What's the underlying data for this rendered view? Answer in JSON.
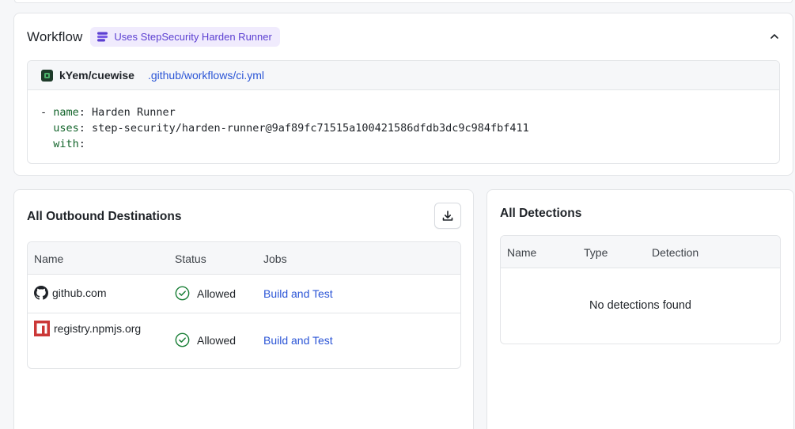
{
  "workflow": {
    "title": "Workflow",
    "badge": "Uses StepSecurity Harden Runner",
    "repo": "kYem/cuewise",
    "file": ".github/workflows/ci.yml",
    "code": {
      "dash": "- ",
      "name_key": "name",
      "name_value": "Harden Runner",
      "uses_key": "uses",
      "uses_value": "step-security/harden-runner@9af89fc71515a100421586dfdb3dc9c984fbf411",
      "with_key": "with"
    }
  },
  "outbound": {
    "title": "All Outbound Destinations",
    "columns": [
      "Name",
      "Status",
      "Jobs"
    ],
    "rows": [
      {
        "name": "github.com",
        "status": "Allowed",
        "job": "Build and Test"
      },
      {
        "name": "registry.npmjs.org",
        "status": "Allowed",
        "job": "Build and Test"
      }
    ]
  },
  "detections": {
    "title": "All Detections",
    "columns": [
      "Name",
      "Type",
      "Detection"
    ],
    "empty": "No detections found"
  },
  "colors": {
    "accent_purple": "#5b3fd1",
    "link_blue": "#2b55d6",
    "allowed_green": "#1a7f37",
    "npm_red": "#cb3837"
  }
}
